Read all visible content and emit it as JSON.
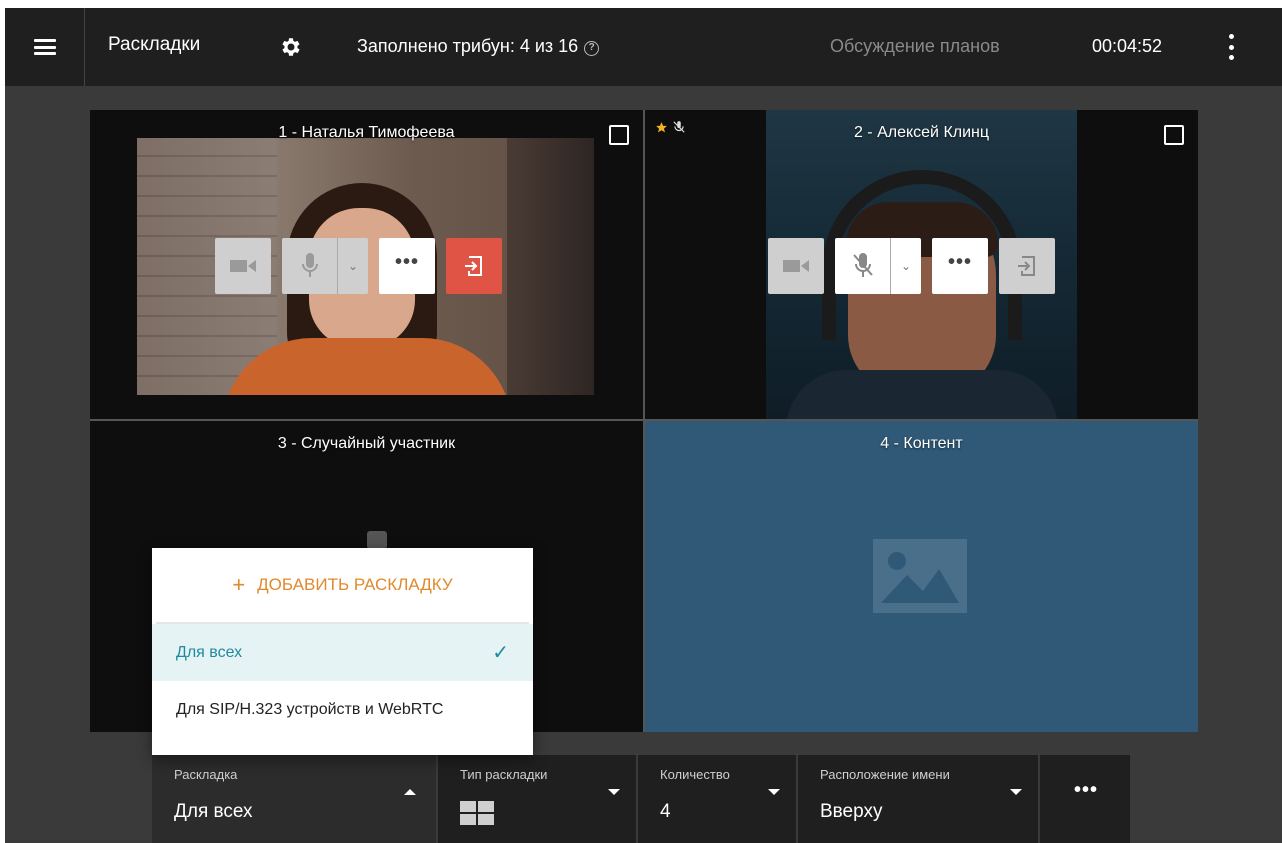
{
  "header": {
    "title": "Раскладки",
    "tribunes_filled": "Заполнено трибун: 4 из 16",
    "help_glyph": "?",
    "conference_name": "Обсуждение планов",
    "timer": "00:04:52"
  },
  "tiles": [
    {
      "name": "1 - Наталья Тимофеева"
    },
    {
      "name": "2 - Алексей Клинц"
    },
    {
      "name": "3 - Случайный участник"
    },
    {
      "name": "4 - Контент"
    }
  ],
  "controls": {
    "more_glyph": "•••",
    "chevron_glyph": "⌄"
  },
  "dropdown": {
    "add_label": "ДОБАВИТЬ РАСКЛАДКУ",
    "add_glyph": "+",
    "items": [
      {
        "label": "Для всех",
        "selected": true
      },
      {
        "label": "Для SIP/H.323 устройств и WebRTC",
        "selected": false
      }
    ],
    "check_glyph": "✓"
  },
  "bottombar": {
    "layout_label": "Раскладка",
    "layout_value": "Для всех",
    "type_label": "Тип раскладки",
    "count_label": "Количество",
    "count_value": "4",
    "name_pos_label": "Расположение имени",
    "name_pos_value": "Вверху",
    "more_glyph": "•••"
  },
  "colors": {
    "accent_orange": "#e08a2c",
    "accent_teal": "#1e8a9e",
    "kick_red": "#e05446",
    "content_blue": "#2f5977"
  }
}
